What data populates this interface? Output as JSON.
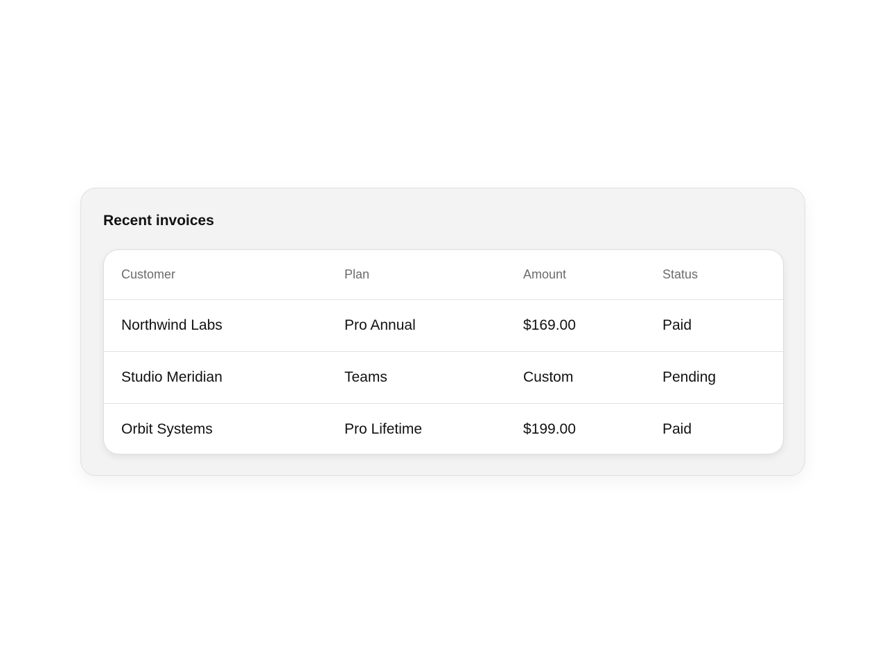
{
  "card": {
    "title": "Recent invoices"
  },
  "table": {
    "columns": [
      "Customer",
      "Plan",
      "Amount",
      "Status"
    ],
    "rows": [
      {
        "customer": "Northwind Labs",
        "plan": "Pro Annual",
        "amount": "$169.00",
        "status": "Paid"
      },
      {
        "customer": "Studio Meridian",
        "plan": "Teams",
        "amount": "Custom",
        "status": "Pending"
      },
      {
        "customer": "Orbit Systems",
        "plan": "Pro Lifetime",
        "amount": "$199.00",
        "status": "Paid"
      }
    ]
  }
}
